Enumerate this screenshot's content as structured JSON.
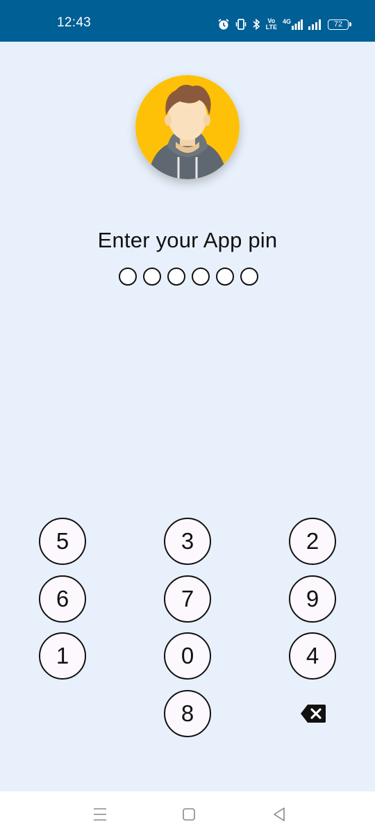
{
  "status_bar": {
    "time": "12:43",
    "volte_top": "Vo",
    "volte_bottom": "LTE",
    "network": "4G",
    "battery": "72",
    "background": "#005f95"
  },
  "avatar": {
    "icon": "user-avatar-icon",
    "background": "#ffc107"
  },
  "pin": {
    "prompt": "Enter your App pin",
    "length": 6,
    "entered": 0
  },
  "keypad": {
    "keys": [
      "5",
      "3",
      "2",
      "6",
      "7",
      "9",
      "1",
      "0",
      "4",
      "8"
    ],
    "backspace_icon": "backspace-icon"
  },
  "nav_bar": {
    "recent": "recent-apps-icon",
    "home": "home-icon",
    "back": "back-icon"
  }
}
